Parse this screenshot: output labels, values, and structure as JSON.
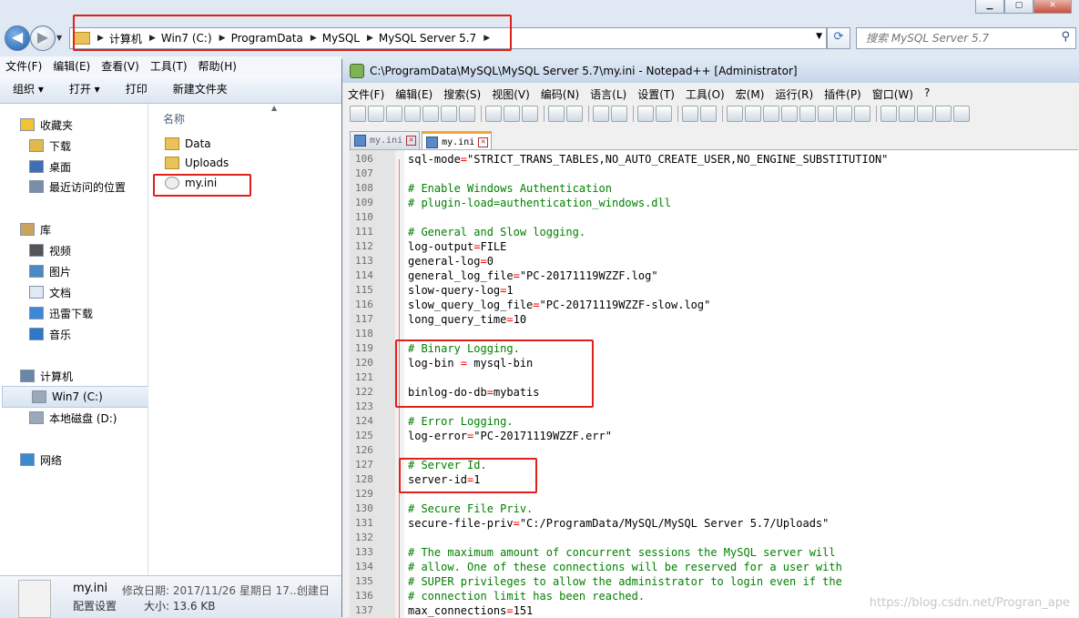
{
  "explorer": {
    "breadcrumb": [
      "计算机",
      "Win7 (C:)",
      "ProgramData",
      "MySQL",
      "MySQL Server 5.7"
    ],
    "search_placeholder": "搜索 MySQL Server 5.7",
    "menu": [
      "文件(F)",
      "编辑(E)",
      "查看(V)",
      "工具(T)",
      "帮助(H)"
    ],
    "commands": [
      "组织 ▾",
      "打开 ▾",
      "打印",
      "新建文件夹"
    ],
    "sidebar": [
      {
        "label": "收藏夹",
        "icon": "star-icon"
      },
      {
        "label": "下载",
        "icon": "download-folder-icon"
      },
      {
        "label": "桌面",
        "icon": "desktop-icon"
      },
      {
        "label": "最近访问的位置",
        "icon": "recent-places-icon"
      },
      {
        "label": "库",
        "icon": "library-icon"
      },
      {
        "label": "视频",
        "icon": "video-icon"
      },
      {
        "label": "图片",
        "icon": "picture-icon"
      },
      {
        "label": "文档",
        "icon": "document-icon"
      },
      {
        "label": "迅雷下载",
        "icon": "thunder-download-icon"
      },
      {
        "label": "音乐",
        "icon": "music-icon"
      },
      {
        "label": "计算机",
        "icon": "computer-icon"
      },
      {
        "label": "Win7 (C:)",
        "icon": "drive-c-icon"
      },
      {
        "label": "本地磁盘 (D:)",
        "icon": "drive-d-icon"
      },
      {
        "label": "网络",
        "icon": "network-icon"
      }
    ],
    "column_header": "名称",
    "files": [
      {
        "name": "Data",
        "type": "folder"
      },
      {
        "name": "Uploads",
        "type": "folder"
      },
      {
        "name": "my.ini",
        "type": "ini"
      }
    ],
    "details": {
      "filename": "my.ini",
      "modified": "修改日期: 2017/11/26 星期日 17...",
      "created": "创建日",
      "type": "配置设置",
      "size": "大小: 13.6 KB"
    }
  },
  "notepad": {
    "title": "C:\\ProgramData\\MySQL\\MySQL Server 5.7\\my.ini - Notepad++ [Administrator]",
    "menu": [
      "文件(F)",
      "编辑(E)",
      "搜索(S)",
      "视图(V)",
      "编码(N)",
      "语言(L)",
      "设置(T)",
      "工具(O)",
      "宏(M)",
      "运行(R)",
      "插件(P)",
      "窗口(W)",
      "?"
    ],
    "tabs": [
      {
        "label": "my.ini",
        "active": false
      },
      {
        "label": "my.ini",
        "active": true
      }
    ],
    "lines": [
      {
        "n": "106",
        "text": "sql-mode=\"STRICT_TRANS_TABLES,NO_AUTO_CREATE_USER,NO_ENGINE_SUBSTITUTION\""
      },
      {
        "n": "107",
        "text": ""
      },
      {
        "n": "108",
        "text": "# Enable Windows Authentication"
      },
      {
        "n": "109",
        "text": "# plugin-load=authentication_windows.dll"
      },
      {
        "n": "110",
        "text": ""
      },
      {
        "n": "111",
        "text": "# General and Slow logging."
      },
      {
        "n": "112",
        "text": "log-output=FILE"
      },
      {
        "n": "113",
        "text": "general-log=0"
      },
      {
        "n": "114",
        "text": "general_log_file=\"PC-20171119WZZF.log\""
      },
      {
        "n": "115",
        "text": "slow-query-log=1"
      },
      {
        "n": "116",
        "text": "slow_query_log_file=\"PC-20171119WZZF-slow.log\""
      },
      {
        "n": "117",
        "text": "long_query_time=10"
      },
      {
        "n": "118",
        "text": ""
      },
      {
        "n": "119",
        "text": "# Binary Logging."
      },
      {
        "n": "120",
        "text": "log-bin = mysql-bin"
      },
      {
        "n": "121",
        "text": ""
      },
      {
        "n": "122",
        "text": "binlog-do-db=mybatis"
      },
      {
        "n": "123",
        "text": ""
      },
      {
        "n": "124",
        "text": "# Error Logging."
      },
      {
        "n": "125",
        "text": "log-error=\"PC-20171119WZZF.err\""
      },
      {
        "n": "126",
        "text": ""
      },
      {
        "n": "127",
        "text": "# Server Id."
      },
      {
        "n": "128",
        "text": "server-id=1"
      },
      {
        "n": "129",
        "text": ""
      },
      {
        "n": "130",
        "text": "# Secure File Priv."
      },
      {
        "n": "131",
        "text": "secure-file-priv=\"C:/ProgramData/MySQL/MySQL Server 5.7/Uploads\""
      },
      {
        "n": "132",
        "text": ""
      },
      {
        "n": "133",
        "text": "# The maximum amount of concurrent sessions the MySQL server will"
      },
      {
        "n": "134",
        "text": "# allow. One of these connections will be reserved for a user with"
      },
      {
        "n": "135",
        "text": "# SUPER privileges to allow the administrator to login even if the"
      },
      {
        "n": "136",
        "text": "# connection limit has been reached."
      },
      {
        "n": "137",
        "text": "max_connections=151"
      }
    ]
  },
  "watermark": "https://blog.csdn.net/Progran_ape"
}
